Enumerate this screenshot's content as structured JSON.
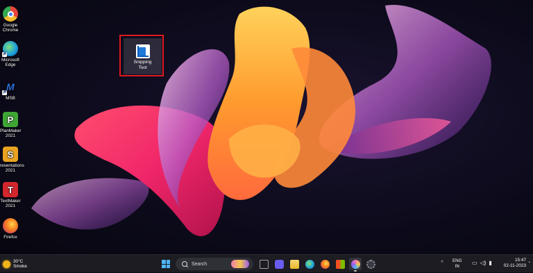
{
  "desktop": {
    "icons": [
      {
        "label": "Google\nChrome",
        "icon": "chrome-icon",
        "color": "#e8453c"
      },
      {
        "label": "Microsoft\nEdge",
        "icon": "edge-icon",
        "color": "#1fa0d8"
      },
      {
        "label": "MSB",
        "icon": "msb-icon",
        "color": "#1f3e8a"
      },
      {
        "label": "PlanMaker\n2021",
        "icon": "planmaker-icon",
        "glyph": "P",
        "color": "#3fa535"
      },
      {
        "label": "resentations\n2021",
        "icon": "presentations-icon",
        "glyph": "S",
        "color": "#e9a320"
      },
      {
        "label": "TextMaker\n2021",
        "icon": "textmaker-icon",
        "glyph": "T",
        "color": "#d4262d"
      },
      {
        "label": "Firefox",
        "icon": "firefox-icon",
        "color": "#f57b1f"
      }
    ],
    "selected_icon": {
      "label": "Snipping\nTool",
      "icon": "snipping-tool-icon",
      "highlight_color": "#e0191f"
    }
  },
  "taskbar": {
    "weather": {
      "temp": "30°C",
      "condition": "Smoke",
      "icon": "sun-icon"
    },
    "search_label": "Search",
    "apps": [
      {
        "name": "task-view-icon",
        "color": "#9aa0a8"
      },
      {
        "name": "meet-icon",
        "color": "#6a5cf0"
      },
      {
        "name": "file-explorer-icon",
        "color": "#f3c94a"
      },
      {
        "name": "edge-icon",
        "color": "#1fa0d8"
      },
      {
        "name": "firefox-icon",
        "color": "#f57b1f"
      },
      {
        "name": "store-icon",
        "color": "#e3e3e3"
      },
      {
        "name": "photos-icon",
        "color": "#f07bb0"
      },
      {
        "name": "settings-icon",
        "color": "#8c9098"
      }
    ],
    "tray": {
      "chevron": "^",
      "lang_line1": "ENG",
      "lang_line2": "IN",
      "time": "15:47",
      "date": "02-11-2023"
    }
  }
}
